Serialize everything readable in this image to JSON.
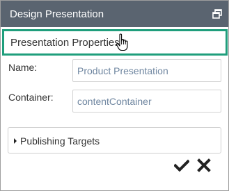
{
  "window": {
    "title": "Design Presentation",
    "restore_icon": "restore-window-icon"
  },
  "section": {
    "label": "Presentation Properties",
    "cursor_icon": "hand-pointer-icon"
  },
  "form": {
    "name_label": "Name:",
    "name_value": "Product Presentation",
    "container_label": "Container:",
    "container_value": "contentContainer"
  },
  "publishing": {
    "label": "Publishing Targets",
    "expanded": false
  },
  "actions": {
    "confirm_icon": "checkmark-icon",
    "cancel_icon": "close-icon"
  },
  "colors": {
    "titlebar": "#5a6470",
    "accent_border": "#1f9e7c",
    "input_text": "#6f86a0"
  }
}
